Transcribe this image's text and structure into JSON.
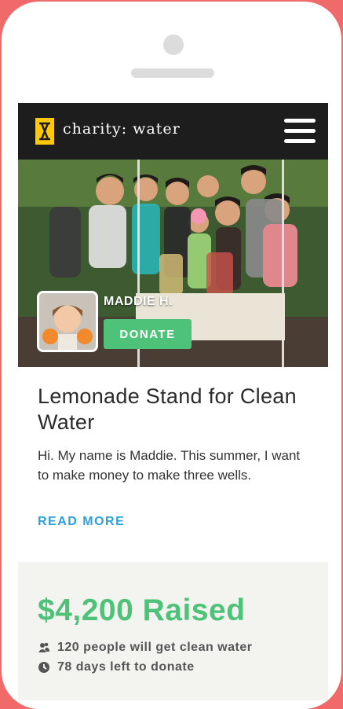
{
  "header": {
    "logo_text": "charity: water",
    "logo_color": "#ffc907",
    "menu_icon": "hamburger-menu-icon"
  },
  "campaign": {
    "fundraiser_name": "MADDIE H.",
    "donate_label": "DONATE",
    "title": "Lemonade Stand for Clean Water",
    "description": "Hi. My name is Maddie. This summer, I want to make money to make three wells.",
    "read_more_label": "READ MORE"
  },
  "stats": {
    "raised": "$4,200 Raised",
    "people": "120 people will get clean water",
    "days": "78 days left to donate",
    "accent_color": "#4fc27a"
  },
  "colors": {
    "frame": "#f06a6a",
    "link": "#2d9fdb"
  }
}
